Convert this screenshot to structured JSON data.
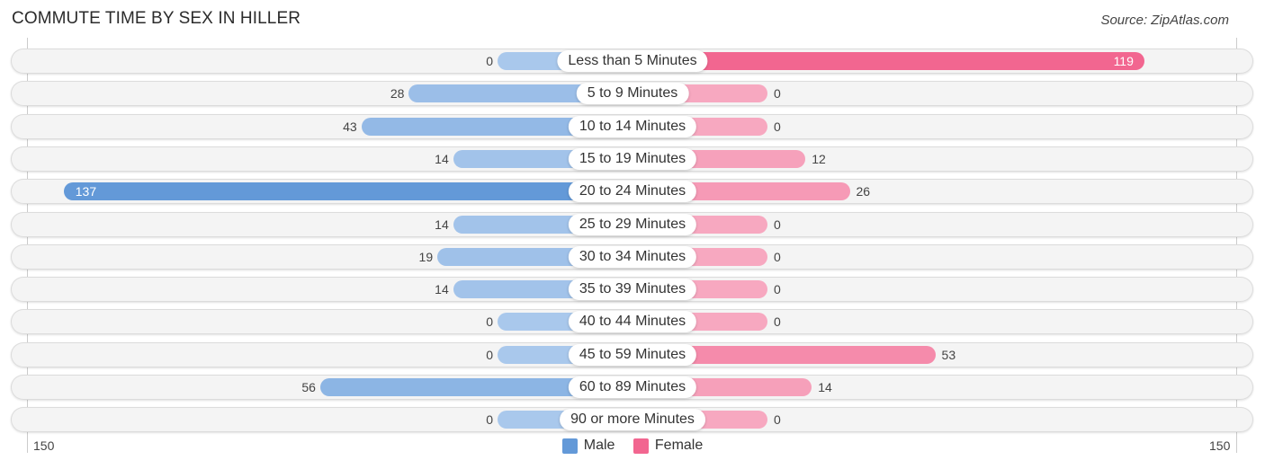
{
  "header": {
    "title": "COMMUTE TIME BY SEX IN HILLER",
    "source": "Source: ZipAtlas.com"
  },
  "colors": {
    "male": "#6399d8",
    "male_light": "#a9c8ec",
    "female": "#f26690",
    "female_light": "#f7a8c0"
  },
  "chart_data": {
    "type": "bar",
    "orientation": "horizontal-diverging",
    "title": "COMMUTE TIME BY SEX IN HILLER",
    "categories": [
      "Less than 5 Minutes",
      "5 to 9 Minutes",
      "10 to 14 Minutes",
      "15 to 19 Minutes",
      "20 to 24 Minutes",
      "25 to 29 Minutes",
      "30 to 34 Minutes",
      "35 to 39 Minutes",
      "40 to 44 Minutes",
      "45 to 59 Minutes",
      "60 to 89 Minutes",
      "90 or more Minutes"
    ],
    "series": [
      {
        "name": "Male",
        "values": [
          0,
          28,
          43,
          14,
          137,
          14,
          19,
          14,
          0,
          0,
          56,
          0
        ]
      },
      {
        "name": "Female",
        "values": [
          119,
          0,
          0,
          12,
          26,
          0,
          0,
          0,
          0,
          53,
          14,
          0
        ]
      }
    ],
    "axis": {
      "left_tick": "150",
      "right_tick": "150",
      "range": [
        150,
        150
      ]
    },
    "legend": {
      "position": "bottom-center",
      "entries": [
        "Male",
        "Female"
      ]
    },
    "grid": false
  }
}
